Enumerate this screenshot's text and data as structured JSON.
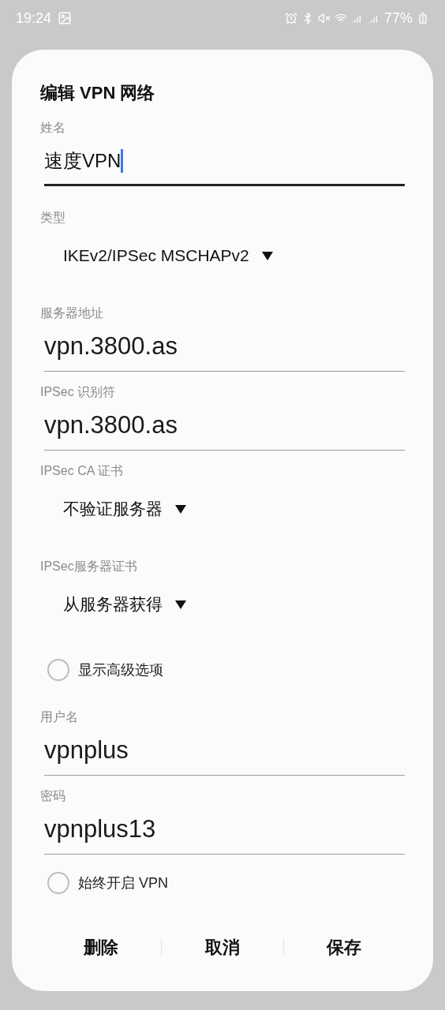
{
  "status_bar": {
    "time": "19:24",
    "battery": "77%"
  },
  "dialog": {
    "title": "编辑 VPN 网络",
    "fields": [
      {
        "kind": "text",
        "label": "姓名",
        "value": "速度VPN",
        "focused": true
      },
      {
        "kind": "dropdown",
        "label": "类型",
        "value": "IKEv2/IPSec MSCHAPv2"
      },
      {
        "kind": "text",
        "label": "服务器地址",
        "value": "vpn.3800.as",
        "focused": false
      },
      {
        "kind": "text",
        "label": "IPSec 识别符",
        "value": "vpn.3800.as",
        "focused": false
      },
      {
        "kind": "dropdown",
        "label": "IPSec CA 证书",
        "value": "不验证服务器"
      },
      {
        "kind": "dropdown",
        "label": "IPSec服务器证书",
        "value": "从服务器获得"
      },
      {
        "kind": "checkbox",
        "label": "显示高级选项",
        "checked": false
      },
      {
        "kind": "text",
        "label": "用户名",
        "value": "vpnplus",
        "focused": false
      },
      {
        "kind": "text",
        "label": "密码",
        "value": "vpnplus13",
        "focused": false
      },
      {
        "kind": "checkbox",
        "label": "始终开启 VPN",
        "checked": false
      }
    ],
    "buttons": [
      "删除",
      "取消",
      "保存"
    ]
  }
}
